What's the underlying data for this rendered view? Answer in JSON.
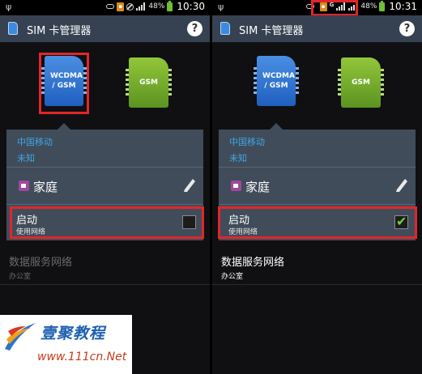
{
  "screens": [
    {
      "status": {
        "battery": "48%",
        "time": "10:30",
        "network_letter": ""
      },
      "app_title": "SIM 卡管理器",
      "help_label": "?",
      "sim1_label": "WCDMA / GSM",
      "sim2_label": "GSM",
      "carrier": "中国移动",
      "carrier_sub": "未知",
      "sim_name": "家庭",
      "enable_label": "启动",
      "enable_sub": "使用网络",
      "enabled": false,
      "data_service": "数据服务网络",
      "data_service_sub": "办公室"
    },
    {
      "status": {
        "battery": "48%",
        "time": "10:31",
        "network_letter": "G"
      },
      "app_title": "SIM 卡管理器",
      "help_label": "?",
      "sim1_label": "WCDMA / GSM",
      "sim2_label": "GSM",
      "carrier": "中国移动",
      "carrier_sub": "未知",
      "sim_name": "家庭",
      "enable_label": "启动",
      "enable_sub": "使用网络",
      "enabled": true,
      "data_service": "数据服务网络",
      "data_service_sub": "办公室"
    }
  ],
  "watermark": {
    "brand": "壹聚教程",
    "url": "www.111cn.Net"
  },
  "colors": {
    "accent_blue": "#3fa6e6",
    "highlight_red": "#e1262b",
    "checkbox_green": "#6fd13c",
    "panel": "#414c5a",
    "title_bar": "#364251"
  }
}
